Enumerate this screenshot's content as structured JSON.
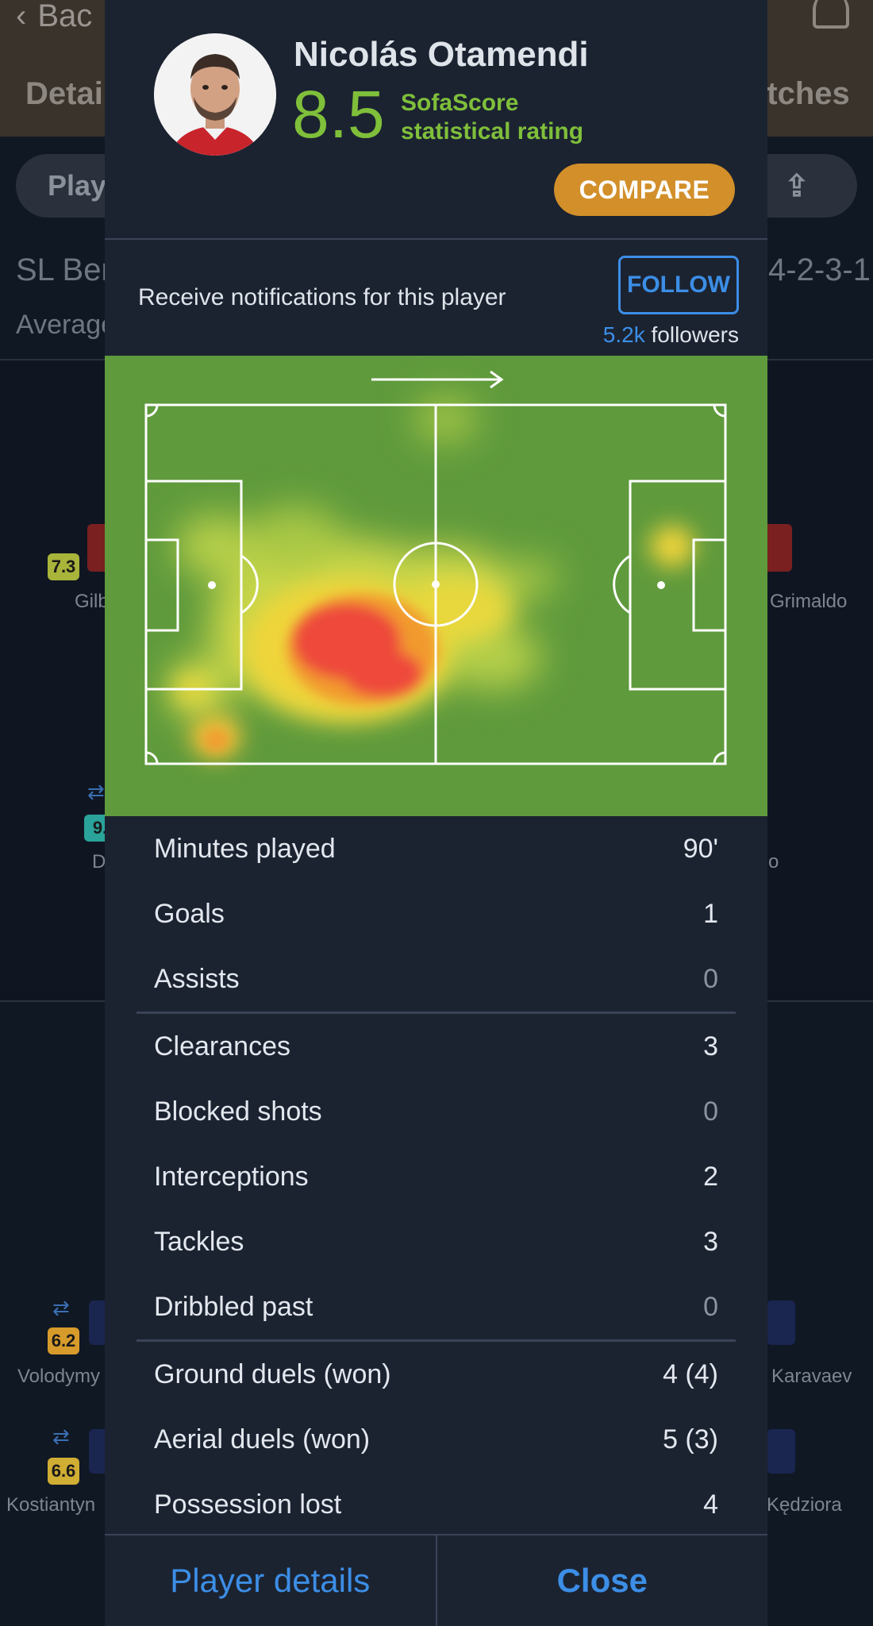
{
  "background": {
    "back_label": "Bac",
    "tabs": [
      "Detail",
      "atches"
    ],
    "pill_left": "Playe",
    "pill_right": "e",
    "team": "SL Ben",
    "formation": "4-2-3-1",
    "average": "Average",
    "players": [
      {
        "rating": "7.3",
        "name": "Gilb",
        "color": "#a9b43a"
      },
      {
        "rating": "9.",
        "name": "D",
        "color": "#2aa39a"
      },
      {
        "name": "Grimaldo"
      },
      {
        "name": "o"
      },
      {
        "rating": "6.2",
        "name": "Volodymy",
        "color": "#d79b2b"
      },
      {
        "rating": "6.6",
        "name": "Kostiantyn",
        "color": "#d0ad33"
      },
      {
        "name": "Karavaev"
      },
      {
        "name": "Kędziora"
      }
    ]
  },
  "player": {
    "name": "Nicolás Otamendi",
    "rating": "8.5",
    "rating_label_line1": "SofaScore",
    "rating_label_line2": "statistical rating",
    "compare_label": "COMPARE"
  },
  "notifications": {
    "label": "Receive notifications for this player",
    "follow_label": "FOLLOW",
    "followers_count": "5.2k",
    "followers_label": "followers"
  },
  "stats_groups": [
    [
      {
        "label": "Minutes played",
        "value": "90'"
      },
      {
        "label": "Goals",
        "value": "1"
      },
      {
        "label": "Assists",
        "value": "0"
      }
    ],
    [
      {
        "label": "Clearances",
        "value": "3"
      },
      {
        "label": "Blocked shots",
        "value": "0"
      },
      {
        "label": "Interceptions",
        "value": "2"
      },
      {
        "label": "Tackles",
        "value": "3"
      },
      {
        "label": "Dribbled past",
        "value": "0"
      }
    ],
    [
      {
        "label": "Ground duels (won)",
        "value": "4 (4)"
      },
      {
        "label": "Aerial duels (won)",
        "value": "5 (3)"
      },
      {
        "label": "Possession lost",
        "value": "4"
      }
    ]
  ],
  "footer": {
    "details_label": "Player details",
    "close_label": "Close"
  },
  "colors": {
    "accent_blue": "#3c8ee6",
    "rating_green": "#7fbf3a",
    "compare_orange": "#d28f2a",
    "pitch_green": "#5f9a3c"
  }
}
